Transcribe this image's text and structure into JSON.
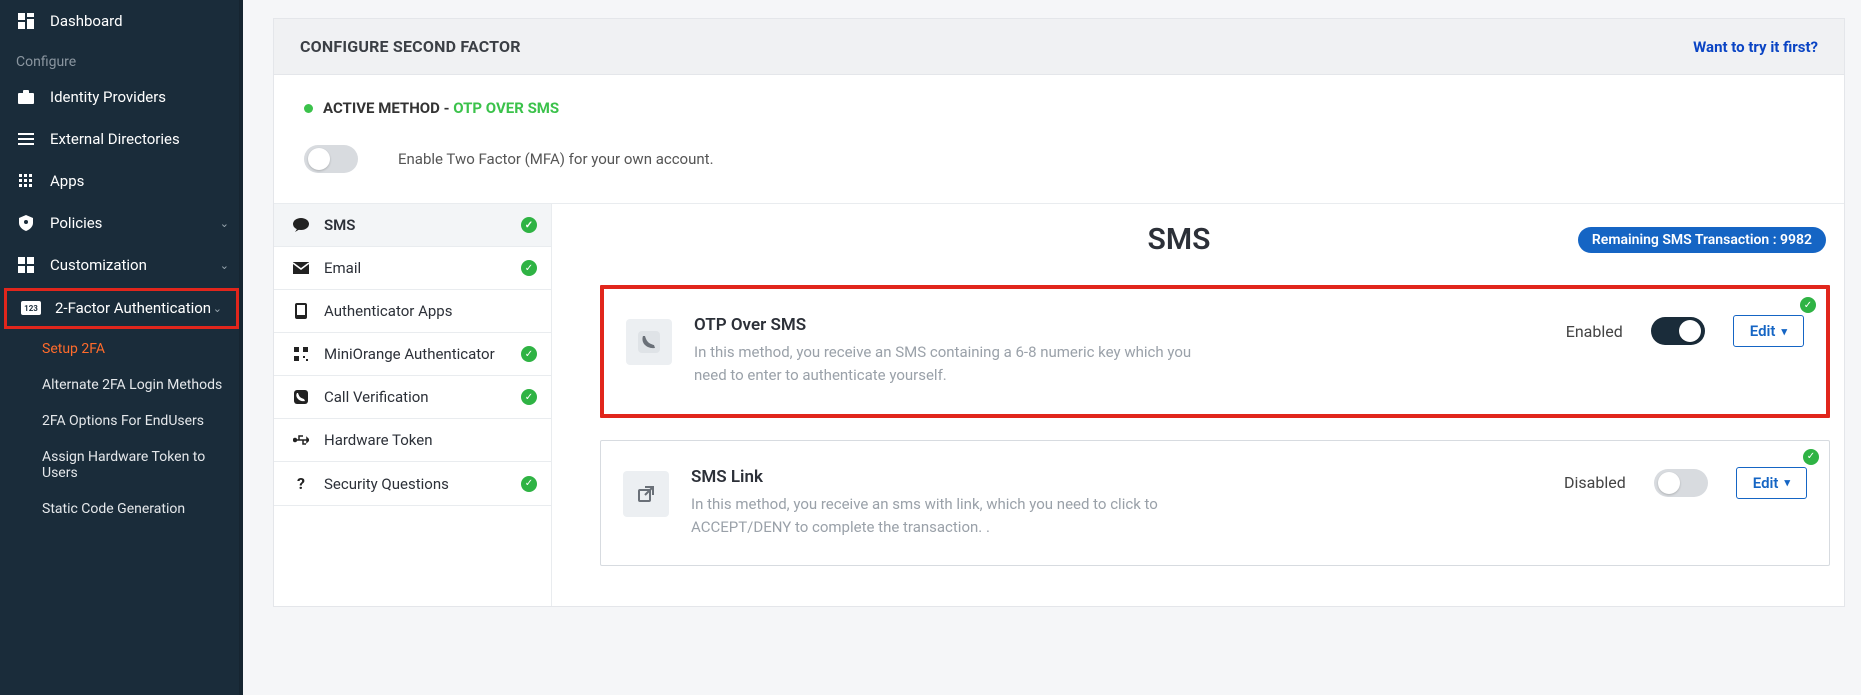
{
  "sidebar": {
    "dashboard": "Dashboard",
    "configure_header": "Configure",
    "identity_providers": "Identity Providers",
    "external_directories": "External Directories",
    "apps": "Apps",
    "policies": "Policies",
    "customization": "Customization",
    "two_factor": "2-Factor Authentication",
    "sub": {
      "setup": "Setup 2FA",
      "alternate": "Alternate 2FA Login Methods",
      "options": "2FA Options For EndUsers",
      "assign": "Assign Hardware Token to Users",
      "static": "Static Code Generation"
    }
  },
  "header": {
    "title": "CONFIGURE SECOND FACTOR",
    "try_link": "Want to try it first?"
  },
  "active": {
    "label": "ACTIVE METHOD - ",
    "method": "OTP OVER SMS"
  },
  "enable_toggle_label": "Enable Two Factor (MFA) for your own account.",
  "tabs": {
    "sms": "SMS",
    "email": "Email",
    "auth_apps": "Authenticator Apps",
    "mini": "MiniOrange Authenticator",
    "call": "Call Verification",
    "hw": "Hardware Token",
    "sq": "Security Questions"
  },
  "content": {
    "heading": "SMS",
    "badge_prefix": "Remaining SMS Transaction : ",
    "badge_count": "9982",
    "methods": [
      {
        "title": "OTP Over SMS",
        "desc": "In this method, you receive an SMS containing a 6-8 numeric key which you need to enter to authenticate yourself.",
        "status": "Enabled",
        "enabled": true,
        "edit": "Edit"
      },
      {
        "title": "SMS Link",
        "desc": "In this method, you receive an sms with link, which you need to click to ACCEPT/DENY to complete the transaction. .",
        "status": "Disabled",
        "enabled": false,
        "edit": "Edit"
      }
    ]
  }
}
